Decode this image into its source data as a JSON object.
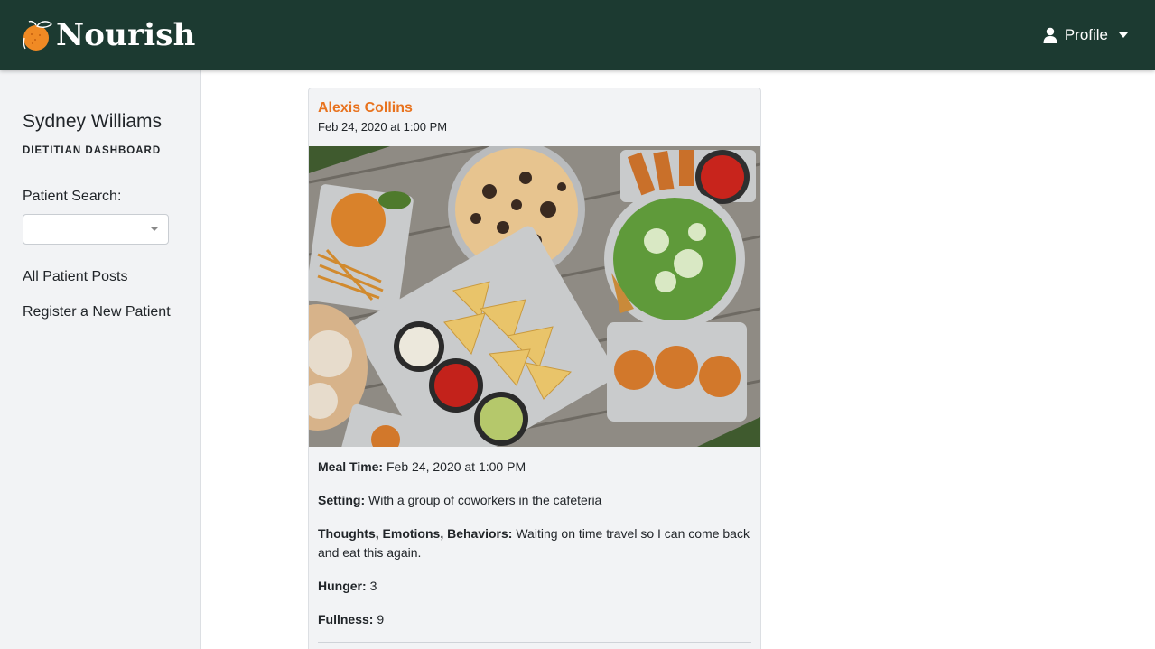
{
  "app": {
    "brand": "Nourish"
  },
  "header": {
    "profile_label": "Profile"
  },
  "sidebar": {
    "user_name": "Sydney Williams",
    "user_role": "DIETITIAN DASHBOARD",
    "search_label": "Patient Search:",
    "search_value": "",
    "links": [
      "All Patient Posts",
      "Register a New Patient"
    ]
  },
  "post": {
    "author": "Alexis Collins",
    "date": "Feb 24, 2020 at 1:00 PM",
    "details": [
      {
        "label": "Meal Time:",
        "value": "Feb 24, 2020 at 1:00 PM"
      },
      {
        "label": "Setting:",
        "value": "With a group of coworkers in the cafeteria"
      },
      {
        "label": "Thoughts, Emotions, Behaviors:",
        "value": "Waiting on time travel so I can come back and eat this again."
      },
      {
        "label": "Hunger:",
        "value": "3"
      },
      {
        "label": "Fullness:",
        "value": "9"
      }
    ]
  },
  "colors": {
    "navbar": "#1c3a31",
    "accent": "#e8731f",
    "sidebar_bg": "#f2f3f5"
  },
  "icons": [
    "orange-logo-icon",
    "user-icon",
    "caret-down-icon",
    "dropdown-arrow-icon"
  ]
}
